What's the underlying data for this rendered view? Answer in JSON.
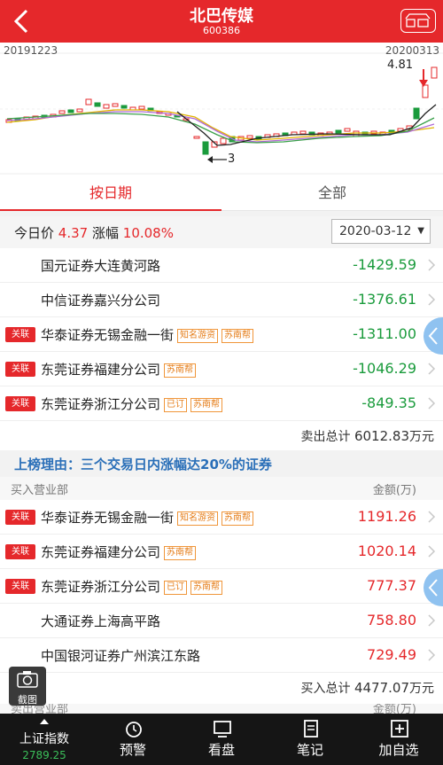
{
  "header": {
    "title": "北巴传媒",
    "code": "600386"
  },
  "chart_labels": {
    "start_date": "20191223",
    "end_date": "20200313",
    "high": "4.81",
    "low": "3"
  },
  "tabs": [
    {
      "label": "按日期"
    },
    {
      "label": "全部"
    }
  ],
  "price": {
    "label": "今日价",
    "value": "4.37",
    "change_label": "涨幅",
    "change": "10.08%"
  },
  "date_select": "2020-03-12",
  "sell_rows": [
    {
      "name": "国元证券大连黄河路",
      "amount": "-1429.59"
    },
    {
      "name": "中信证券嘉兴分公司",
      "amount": "-1376.61"
    },
    {
      "badge": "关联",
      "name": "华泰证券无锡金融一街",
      "tags": [
        "知名游资",
        "苏南帮"
      ],
      "amount": "-1311.00"
    },
    {
      "badge": "关联",
      "name": "东莞证券福建分公司",
      "tags": [
        "苏南帮"
      ],
      "amount": "-1046.29"
    },
    {
      "badge": "关联",
      "name": "东莞证券浙江分公司",
      "tags": [
        "已订",
        "苏南帮"
      ],
      "amount": "-849.35"
    }
  ],
  "sell_total": {
    "label": "卖出总计",
    "value": "6012.83",
    "unit": "万元"
  },
  "reason": "上榜理由：三个交易日内涨幅达20%的证券",
  "buy_header": {
    "left": "买入营业部",
    "right": "金额(万)"
  },
  "buy_rows": [
    {
      "badge": "关联",
      "name": "华泰证券无锡金融一街",
      "tags": [
        "知名游资",
        "苏南帮"
      ],
      "amount": "1191.26"
    },
    {
      "badge": "关联",
      "name": "东莞证券福建分公司",
      "tags": [
        "苏南帮"
      ],
      "amount": "1020.14"
    },
    {
      "badge": "关联",
      "name": "东莞证券浙江分公司",
      "tags": [
        "已订",
        "苏南帮"
      ],
      "amount": "777.37"
    },
    {
      "name": "大通证券上海高平路",
      "amount": "758.80"
    },
    {
      "name": "中国银河证券广州滨江东路",
      "amount": "729.49"
    }
  ],
  "buy_total": {
    "label": "买入总计",
    "value": "4477.07",
    "unit": "万元"
  },
  "partial_header": {
    "left": "卖出营业部",
    "right": "金额(万)"
  },
  "screenshot_label": "截图",
  "bottom_nav": [
    {
      "label": "上证指数",
      "sub": "2789.25"
    },
    {
      "label": "预警"
    },
    {
      "label": "看盘"
    },
    {
      "label": "笔记"
    },
    {
      "label": "加自选"
    }
  ],
  "colors": {
    "brand_red": "#e5282b",
    "green": "#1a9b3c",
    "link_blue": "#2a6fb8"
  }
}
